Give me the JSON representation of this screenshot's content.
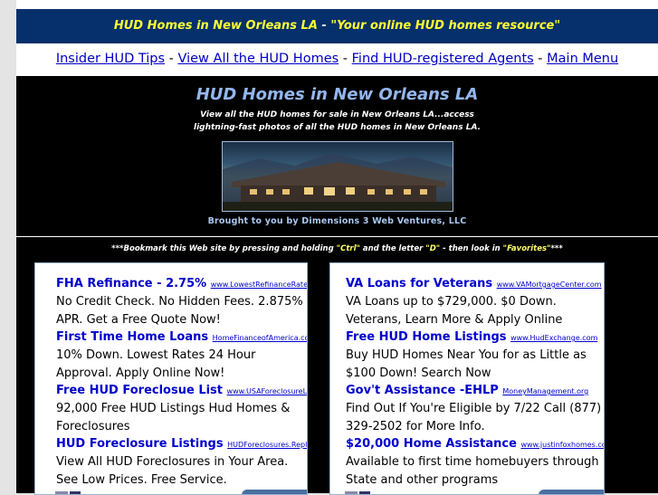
{
  "topbar": {
    "title": "HUD Homes in New Orleans LA",
    "separator": " - ",
    "tagline": "\"Your online HUD homes resource\""
  },
  "nav": {
    "items": [
      "Insider HUD Tips",
      "View All the HUD Homes",
      "Find HUD-registered Agents",
      "Main Menu"
    ],
    "separator": " - "
  },
  "banner": {
    "heading": "HUD Homes in New Orleans LA",
    "sub_line1": "View all the HUD homes for sale in New Orleans LA...access",
    "sub_line2": "lightning-fast photos of all the HUD homes in New Orleans LA.",
    "brought": "Brought to you by Dimensions 3 Web Ventures, LLC"
  },
  "bookmark": {
    "p1": "***Bookmark this Web site by pressing and holding ",
    "k1": "\"Ctrl\"",
    "p2": " and the letter ",
    "k2": "\"D\"",
    "p3": " - then look in ",
    "k3": "\"Favorites\"",
    "p4": "***"
  },
  "ads_left": [
    {
      "title": "FHA Refinance - 2.75%",
      "url": "www.LowestRefinanceRatesOnline.",
      "desc": "No Credit Check. No Hidden Fees. 2.875% APR. Get a Free Quote Now!"
    },
    {
      "title": "First Time Home Loans",
      "url": "HomeFinanceofAmerica.com",
      "desc": "10% Down. Lowest Rates 24 Hour Approval. Apply Online Now!"
    },
    {
      "title": "Free HUD Foreclosue List",
      "url": "www.USAForeclosureList.com",
      "desc": "92,000 Free HUD Listings Hud Homes & Foreclosures"
    },
    {
      "title": "HUD Foreclosure Listings",
      "url": "HUDForeclosures.Reply.com",
      "desc": "View All HUD Foreclosures in Your Area. See Low Prices. Free Service."
    }
  ],
  "ads_right": [
    {
      "title": "VA Loans for Veterans",
      "url": "www.VAMortgageCenter.com",
      "desc": "VA Loans up to $729,000. $0 Down. Veterans, Learn More & Apply Online"
    },
    {
      "title": "Free HUD Home Listings",
      "url": "www.HudExchange.com",
      "desc": "Buy HUD Homes Near You for as Little as $100 Down! Search Now"
    },
    {
      "title": "Gov't Assistance -EHLP",
      "url": "MoneyManagement.org",
      "desc": "Find Out If You're Eligible by 7/22 Call (877) 329-2502 for More Info."
    },
    {
      "title": "$20,000 Home Assistance",
      "url": "www.justinfoxhomes.com",
      "desc": "Available to first time homebuyers through State and other programs"
    }
  ]
}
